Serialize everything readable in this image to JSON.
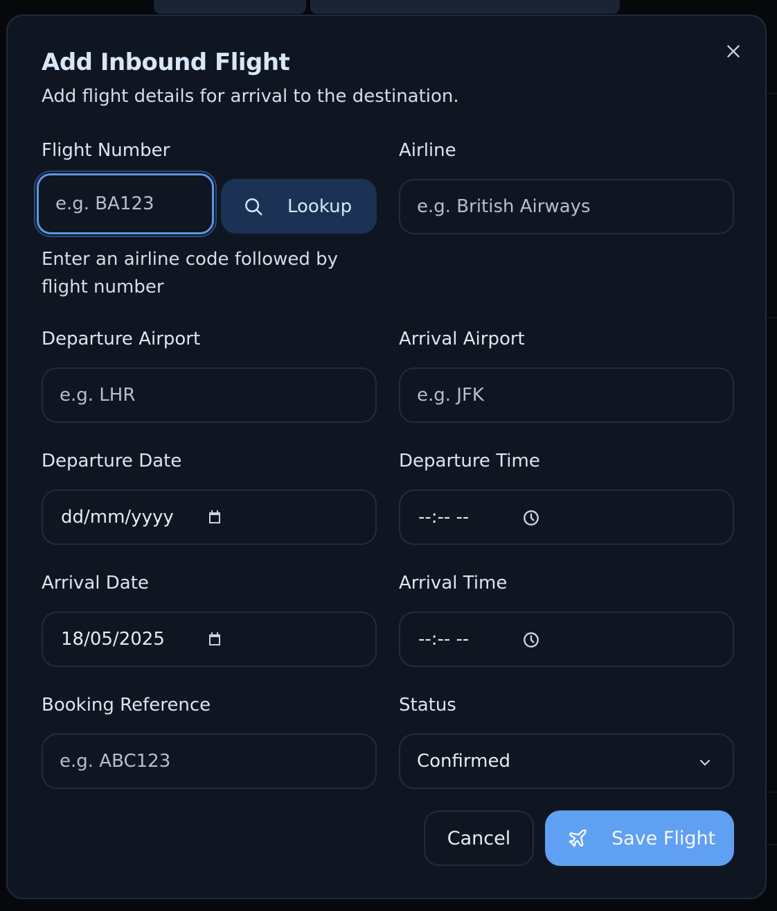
{
  "dialog": {
    "title": "Add Inbound Flight",
    "subtitle": "Add flight details for arrival to the destination.",
    "close_icon": "close-icon"
  },
  "form": {
    "flight_number": {
      "label": "Flight Number",
      "placeholder": "e.g. BA123",
      "help": "Enter an airline code followed by flight number"
    },
    "lookup_button": {
      "label": "Lookup",
      "icon": "search-icon"
    },
    "airline": {
      "label": "Airline",
      "placeholder": "e.g. British Airways"
    },
    "departure_airport": {
      "label": "Departure Airport",
      "placeholder": "e.g. LHR"
    },
    "arrival_airport": {
      "label": "Arrival Airport",
      "placeholder": "e.g. JFK"
    },
    "departure_date": {
      "label": "Departure Date",
      "value": "dd/mm/yyyy",
      "icon": "calendar-icon"
    },
    "departure_time": {
      "label": "Departure Time",
      "value": "--:-- --",
      "icon": "clock-icon"
    },
    "arrival_date": {
      "label": "Arrival Date",
      "value": "18/05/2025",
      "icon": "calendar-icon"
    },
    "arrival_time": {
      "label": "Arrival Time",
      "value": "--:-- --",
      "icon": "clock-icon"
    },
    "booking_reference": {
      "label": "Booking Reference",
      "placeholder": "e.g. ABC123"
    },
    "status": {
      "label": "Status",
      "value": "Confirmed",
      "icon": "chevron-down-icon"
    }
  },
  "actions": {
    "cancel_label": "Cancel",
    "save_label": "Save Flight",
    "save_icon": "plane-icon"
  },
  "colors": {
    "modal_bg": "#0f1621",
    "field_border": "#1f2d43",
    "lookup_bg": "#1c3254",
    "primary": "#60a0f2",
    "focus_ring": "#5d96e8"
  }
}
